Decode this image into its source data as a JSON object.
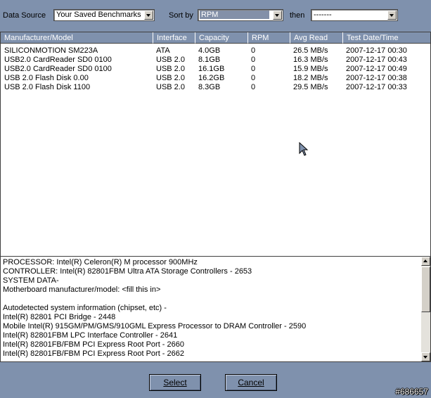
{
  "toolbar": {
    "data_source_label": "Data Source",
    "data_source_value": "Your Saved Benchmarks",
    "sort_by_label": "Sort by",
    "sort_by_value": "RPM",
    "then_label": "then",
    "then_value": "-------"
  },
  "table": {
    "columns": [
      "Manufacturer/Model",
      "Interface",
      "Capacity",
      "RPM",
      "Avg Read",
      "Test Date/Time"
    ],
    "rows": [
      [
        "SILICONMOTION SM223A",
        "ATA",
        "4.0GB",
        "0",
        "26.5 MB/s",
        "2007-12-17 00:30"
      ],
      [
        "USB2.0 CardReader SD0 0100",
        "USB 2.0",
        "8.1GB",
        "0",
        "16.3 MB/s",
        "2007-12-17 00:43"
      ],
      [
        "USB2.0 CardReader SD0 0100",
        "USB 2.0",
        "16.1GB",
        "0",
        "15.9 MB/s",
        "2007-12-17 00:49"
      ],
      [
        "USB 2.0 Flash Disk 0.00",
        "USB 2.0",
        "16.2GB",
        "0",
        "18.2 MB/s",
        "2007-12-17 00:38"
      ],
      [
        "USB 2.0 Flash Disk 1100",
        "USB 2.0",
        "8.3GB",
        "0",
        "29.5 MB/s",
        "2007-12-17 00:33"
      ]
    ]
  },
  "details": {
    "lines": [
      "PROCESSOR: Intel(R) Celeron(R) M processor          900MHz",
      "CONTROLLER: Intel(R) 82801FBM Ultra ATA Storage Controllers - 2653",
      "SYSTEM DATA-",
      "Motherboard manufacturer/model: <fill this in>",
      "",
      "Autodetected system information (chipset, etc) -",
      "Intel(R) 82801 PCI Bridge - 2448",
      "Mobile Intel(R) 915GM/PM/GMS/910GML Express Processor to DRAM Controller - 2590",
      "Intel(R) 82801FBM LPC Interface Controller - 2641",
      "Intel(R) 82801FB/FBM PCI Express Root Port - 2660",
      "Intel(R) 82801FB/FBM PCI Express Root Port - 2662"
    ]
  },
  "buttons": {
    "select_label": "Select",
    "cancel_label": "Cancel"
  },
  "watermark": "#686657",
  "icons": {
    "combo_arrow": "chevron-down-icon",
    "scroll_up": "arrow-up-icon",
    "scroll_down": "arrow-down-icon",
    "cursor": "mouse-pointer-icon"
  },
  "colors": {
    "background": "#7f91ad",
    "header_bg": "#7f91ad",
    "selection": "#8390a8"
  }
}
